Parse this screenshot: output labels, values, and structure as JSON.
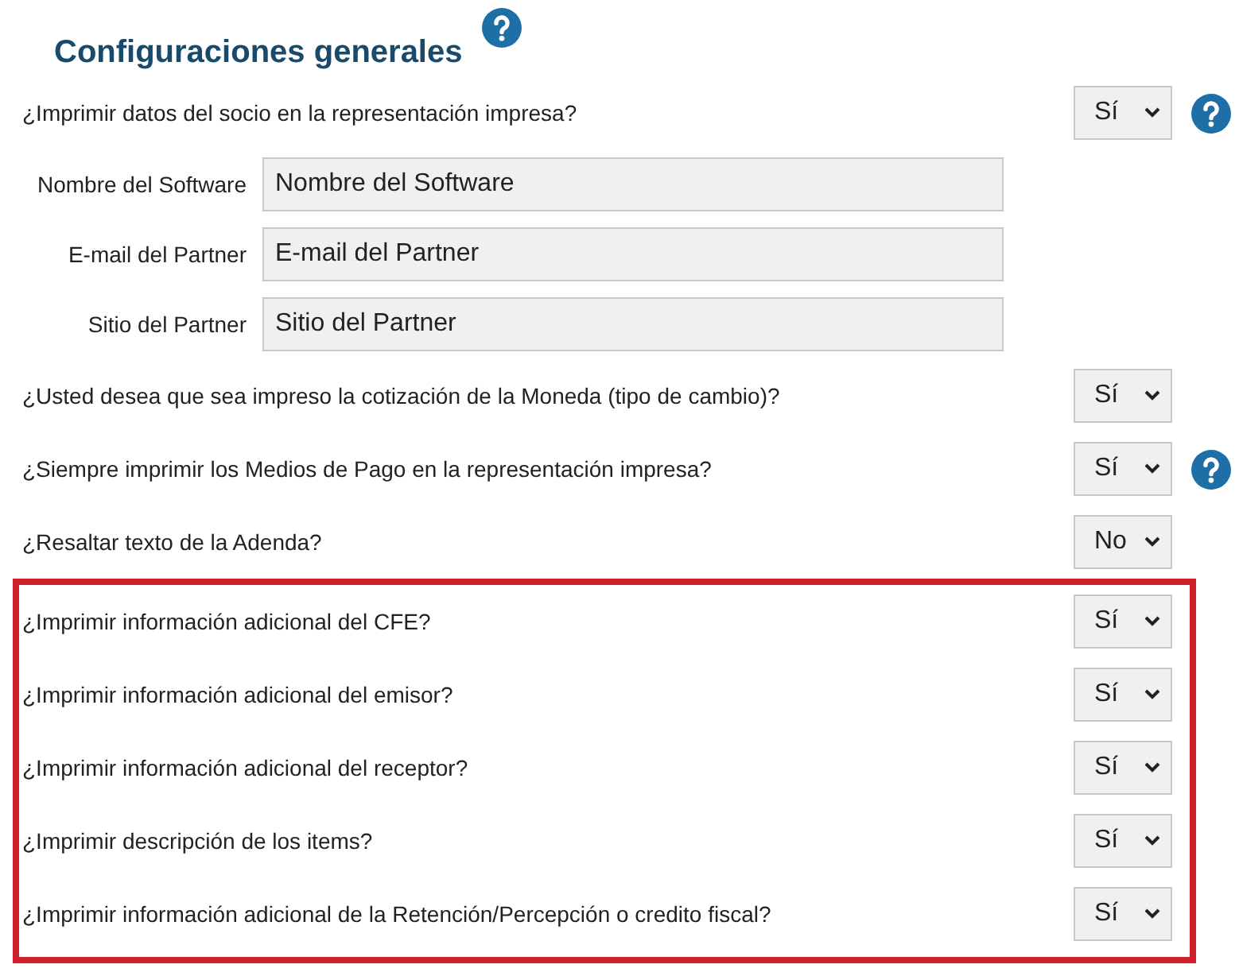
{
  "title": "Configuraciones generales",
  "title_help": true,
  "sections": [
    {
      "highlighted": false,
      "rows": [
        {
          "kind": "question",
          "text": "¿Imprimir datos del socio en la representación impresa?",
          "value": "Sí",
          "help": true
        },
        {
          "kind": "field",
          "label": "Nombre del Software",
          "placeholder": "Nombre del Software"
        },
        {
          "kind": "field",
          "label": "E-mail del Partner",
          "placeholder": "E-mail del Partner"
        },
        {
          "kind": "field",
          "label": "Sitio del Partner",
          "placeholder": "Sitio del Partner"
        },
        {
          "kind": "question",
          "text": "¿Usted desea que sea impreso la cotización de la Moneda (tipo de cambio)?",
          "value": "Sí",
          "help": false
        },
        {
          "kind": "question",
          "text": "¿Siempre imprimir los Medios de Pago en la representación impresa?",
          "value": "Sí",
          "help": true
        },
        {
          "kind": "question",
          "text": "¿Resaltar texto de la Adenda?",
          "value": "No",
          "help": false
        }
      ]
    },
    {
      "highlighted": true,
      "rows": [
        {
          "kind": "question",
          "text": "¿Imprimir información adicional del CFE?",
          "value": "Sí",
          "help": false
        },
        {
          "kind": "question",
          "text": "¿Imprimir información adicional del emisor?",
          "value": "Sí",
          "help": false
        },
        {
          "kind": "question",
          "text": "¿Imprimir información adicional del receptor?",
          "value": "Sí",
          "help": false
        },
        {
          "kind": "question",
          "text": "¿Imprimir descripción de los items?",
          "value": "Sí",
          "help": false
        },
        {
          "kind": "question",
          "text": "¿Imprimir información adicional de la Retención/Percepción o credito fiscal?",
          "value": "Sí",
          "help": false
        }
      ]
    }
  ]
}
